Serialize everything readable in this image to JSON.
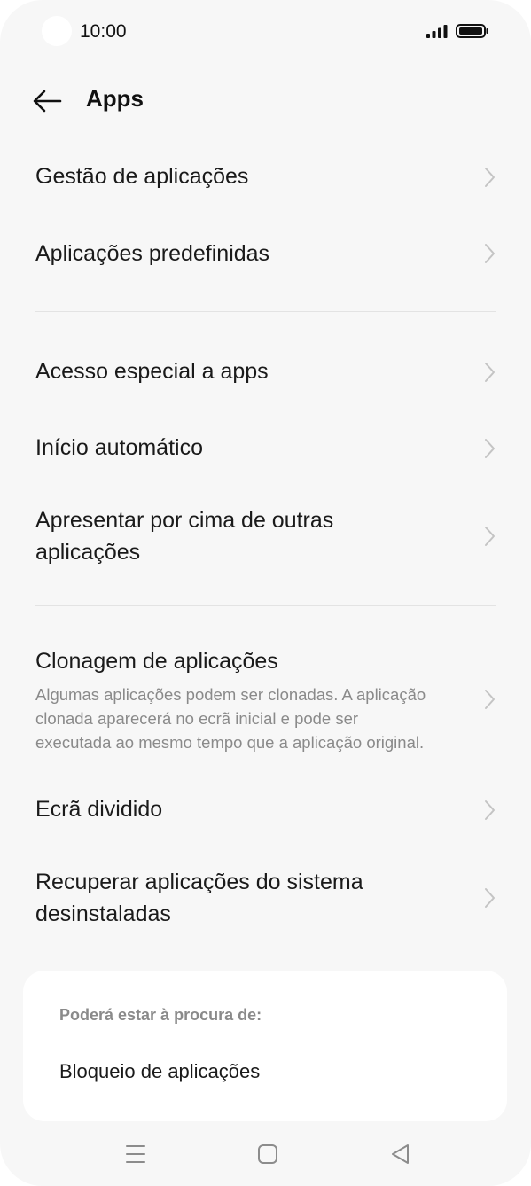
{
  "status_bar": {
    "time": "10:00",
    "signal_icon": "signal-icon",
    "battery_icon": "battery-icon"
  },
  "header": {
    "back_icon": "arrow-left-icon",
    "title": "Apps"
  },
  "menu": {
    "group1": [
      {
        "label": "Gestão de aplicações"
      },
      {
        "label": "Aplicações predefinidas"
      }
    ],
    "group2": [
      {
        "label": "Acesso especial a apps"
      },
      {
        "label": "Início automático"
      },
      {
        "label_line1": "Apresentar por cima de outras",
        "label_line2": "aplicações"
      }
    ],
    "group3": [
      {
        "label": "Clonagem de aplicações",
        "desc_line1": "Algumas aplicações podem ser clonadas. A aplicação",
        "desc_line2": "clonada aparecerá no ecrã inicial e pode ser",
        "desc_line3": "executada ao mesmo tempo que a aplicação original."
      },
      {
        "label": "Ecrã dividido"
      },
      {
        "label_line1": "Recuperar aplicações do sistema",
        "label_line2": "desinstaladas"
      }
    ]
  },
  "suggestions": {
    "heading": "Poderá estar à procura de:",
    "items": [
      {
        "label": "Bloqueio de aplicações"
      }
    ]
  },
  "nav_bar": {
    "icons": [
      "menu-icon",
      "home-icon",
      "back-triangle-icon"
    ]
  },
  "colors": {
    "background": "#f7f7f7",
    "card": "#ffffff",
    "text": "#1a1a1a",
    "secondary_text": "#8a8a8a",
    "chevron": "#c4c4c4",
    "divider": "#e3e3e3"
  }
}
